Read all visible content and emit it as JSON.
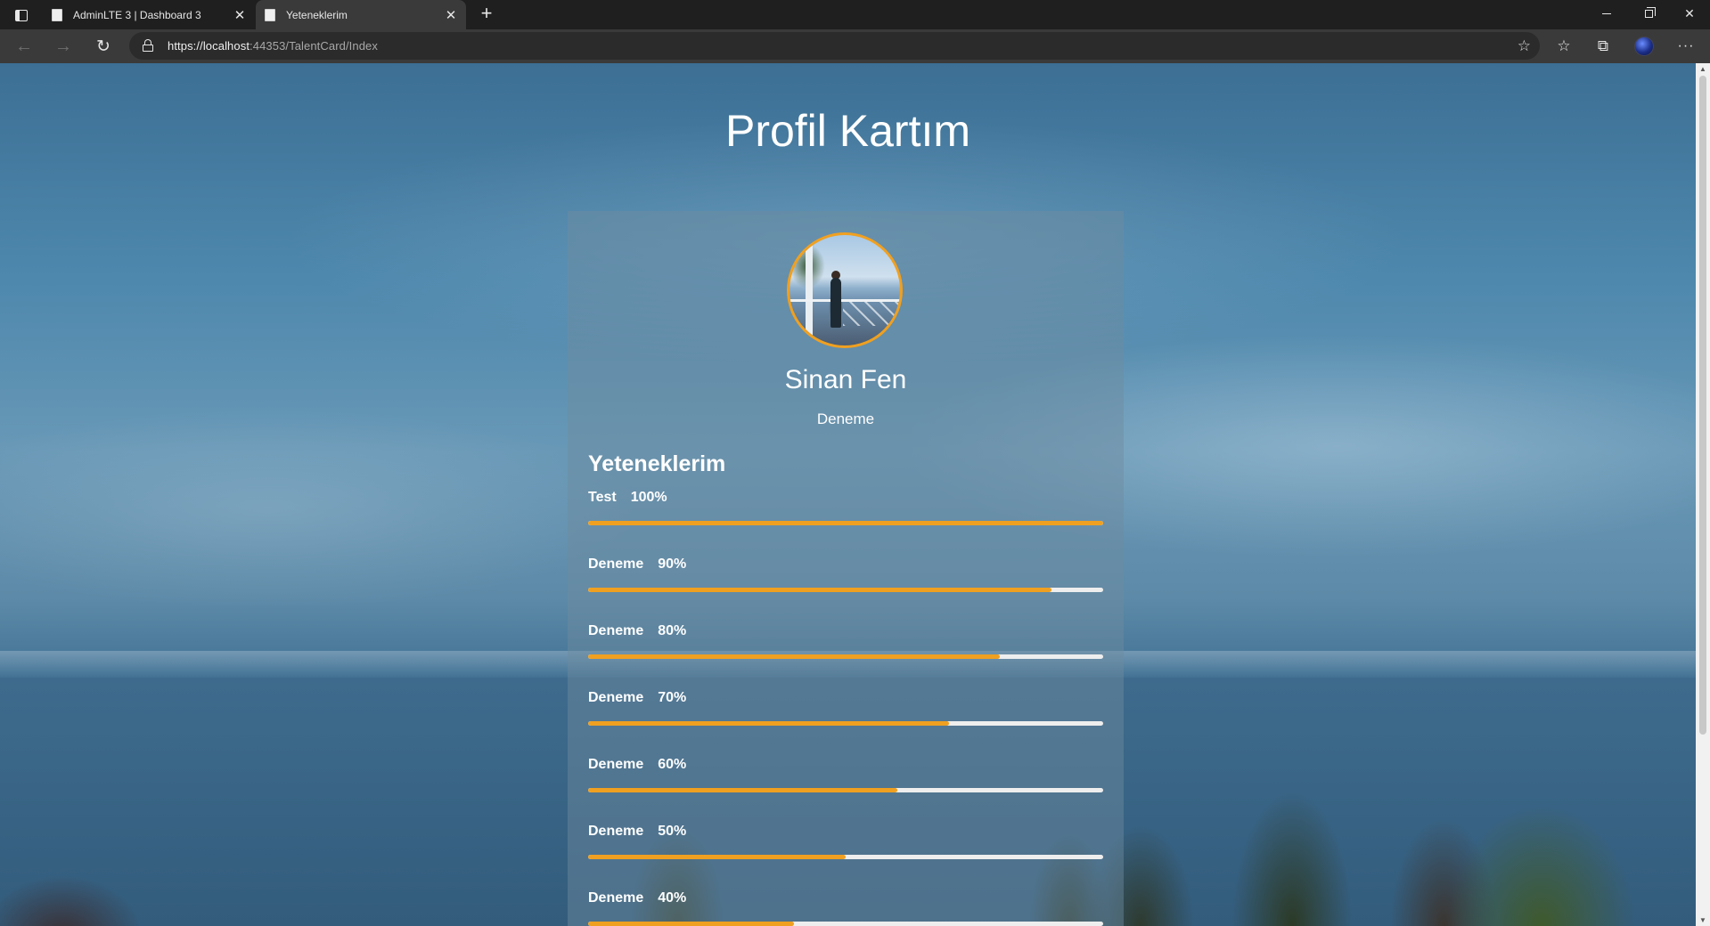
{
  "browser": {
    "tabs": [
      {
        "title": "AdminLTE 3 | Dashboard 3",
        "active": false
      },
      {
        "title": "Yeteneklerim",
        "active": true
      }
    ],
    "url_scheme_host": "https://localhost",
    "url_rest": ":44353/TalentCard/Index"
  },
  "page": {
    "title": "Profil Kartım",
    "profile": {
      "name": "Sinan Fen",
      "subtitle": "Deneme"
    },
    "skills_heading": "Yeteneklerim",
    "skills": [
      {
        "name": "Test",
        "percent_label": "100%",
        "value": 100
      },
      {
        "name": "Deneme",
        "percent_label": "90%",
        "value": 90
      },
      {
        "name": "Deneme",
        "percent_label": "80%",
        "value": 80
      },
      {
        "name": "Deneme",
        "percent_label": "70%",
        "value": 70
      },
      {
        "name": "Deneme",
        "percent_label": "60%",
        "value": 60
      },
      {
        "name": "Deneme",
        "percent_label": "50%",
        "value": 50
      },
      {
        "name": "Deneme",
        "percent_label": "40%",
        "value": 40
      }
    ]
  },
  "colors": {
    "accent": "#f0a020",
    "bar_track": "#eeeeee"
  },
  "icons": {
    "tab_actions": "tab-actions-icon",
    "page": "page-icon",
    "close": "close-icon",
    "new_tab": "plus-icon",
    "back": "arrow-left-icon",
    "forward": "arrow-right-icon",
    "reload": "reload-icon",
    "lock": "lock-icon",
    "favorite": "star-add-icon",
    "favorites": "favorites-icon",
    "collections": "collections-icon",
    "profile": "profile-avatar-icon",
    "more": "more-icon"
  }
}
